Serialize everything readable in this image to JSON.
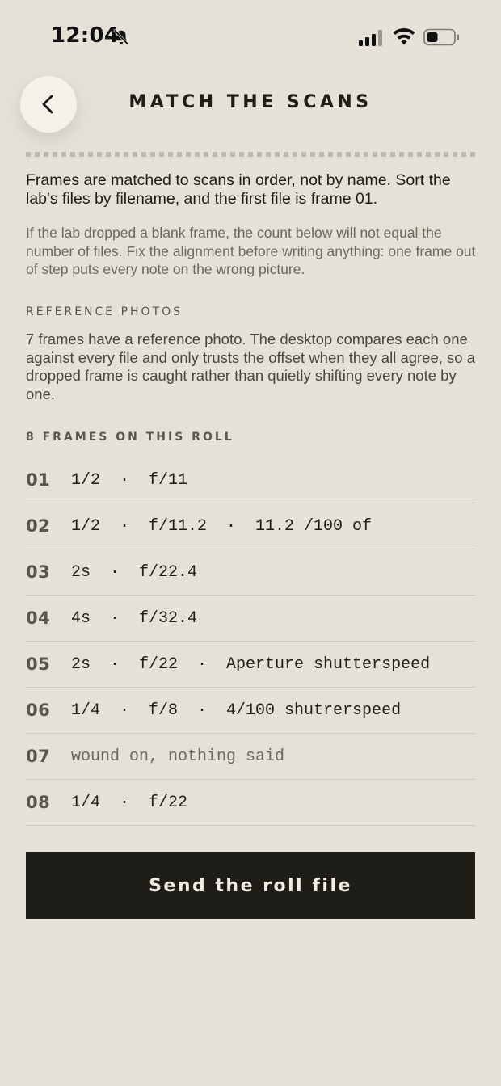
{
  "status_bar": {
    "time": "12:04",
    "icons": [
      "bell-slash-icon",
      "cellular-signal-icon",
      "wifi-icon",
      "battery-icon"
    ]
  },
  "header": {
    "title": "MATCH THE SCANS",
    "back_icon": "chevron-left-icon"
  },
  "intro": {
    "text": "Frames are matched to scans in order, not by name. Sort the lab's files by filename, and the first file is frame 01.",
    "note": "If the lab dropped a blank frame, the count below will not equal the number of files. Fix the alignment before writing anything: one frame out of step puts every note on the wrong picture."
  },
  "reference": {
    "label": "REFERENCE PHOTOS",
    "text": "7 frames have a reference photo. The desktop compares each one against every file and only trusts the offset when they all agree, so a dropped frame is caught rather than quietly shifting every note by one."
  },
  "frames": {
    "label": "8 FRAMES ON THIS ROLL",
    "items": [
      {
        "num": "01",
        "detail": "1/2  ·  f/11"
      },
      {
        "num": "02",
        "detail": "1/2  ·  f/11.2  ·  11.2 /100 of"
      },
      {
        "num": "03",
        "detail": "2s  ·  f/22.4"
      },
      {
        "num": "04",
        "detail": "4s  ·  f/32.4"
      },
      {
        "num": "05",
        "detail": "2s  ·  f/22  ·  Aperture shutterspeed"
      },
      {
        "num": "06",
        "detail": "1/4  ·  f/8  ·  4/100 shutrerspeed"
      },
      {
        "num": "07",
        "detail": "wound on, nothing said"
      },
      {
        "num": "08",
        "detail": "1/4  ·  f/22"
      }
    ]
  },
  "actions": {
    "send_label": "Send the roll file"
  },
  "colors": {
    "background": "#e5e1d6",
    "text": "#1f1d17",
    "muted": "#6c685e",
    "button_bg": "#1f1d17",
    "button_text": "#f1ede2"
  }
}
